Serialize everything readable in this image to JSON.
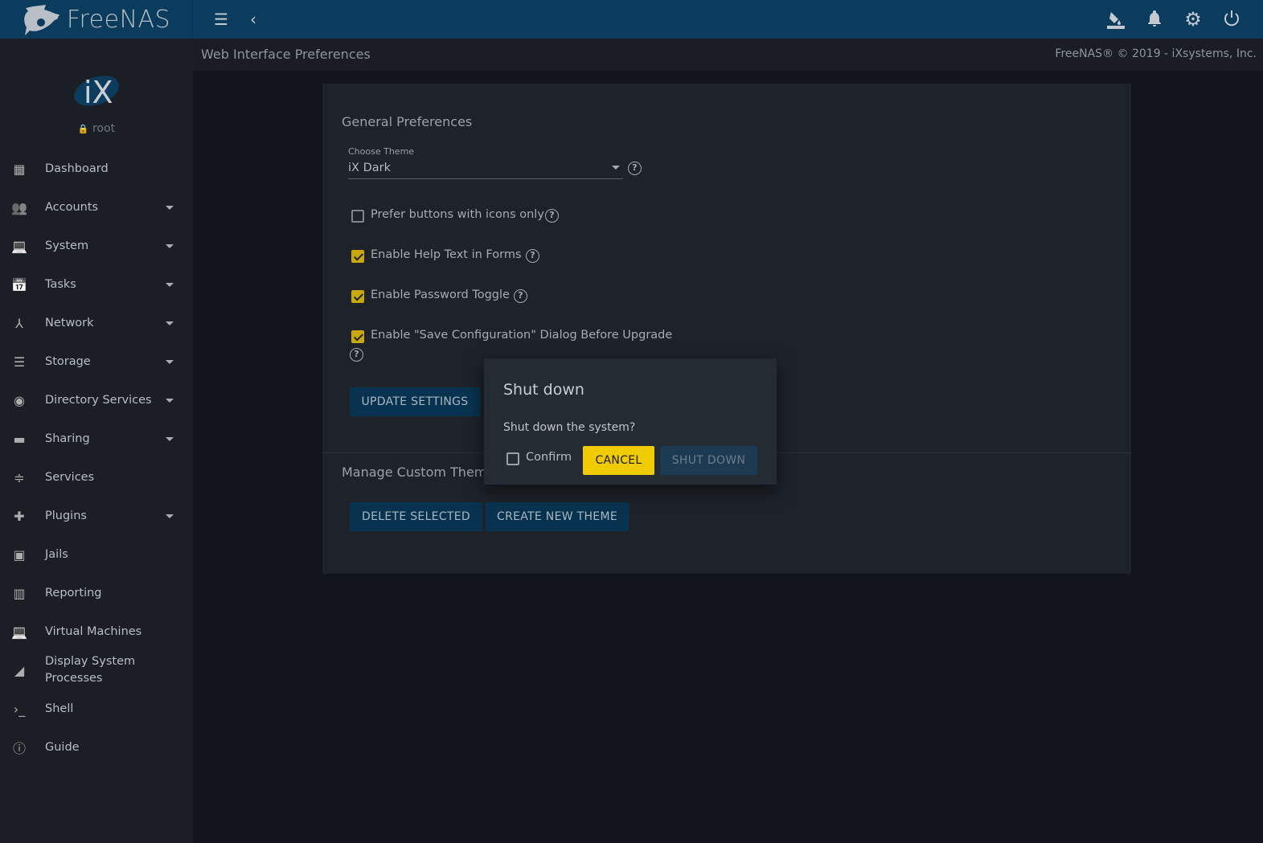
{
  "topbar": {
    "brand": "FreeNAS",
    "icons": [
      "menu-icon",
      "chevron-left-icon",
      "theme-paint-icon",
      "bell-icon",
      "gear-icon",
      "power-icon"
    ]
  },
  "sidebar": {
    "user": "root",
    "items": [
      {
        "label": "Dashboard",
        "icon": "dashboard-icon",
        "expandable": false
      },
      {
        "label": "Accounts",
        "icon": "people-icon",
        "expandable": true
      },
      {
        "label": "System",
        "icon": "laptop-icon",
        "expandable": true
      },
      {
        "label": "Tasks",
        "icon": "calendar-icon",
        "expandable": true
      },
      {
        "label": "Network",
        "icon": "network-icon",
        "expandable": true
      },
      {
        "label": "Storage",
        "icon": "storage-icon",
        "expandable": true
      },
      {
        "label": "Directory Services",
        "icon": "directory-icon",
        "expandable": true
      },
      {
        "label": "Sharing",
        "icon": "folder-shared-icon",
        "expandable": true
      },
      {
        "label": "Services",
        "icon": "tune-icon",
        "expandable": false
      },
      {
        "label": "Plugins",
        "icon": "puzzle-icon",
        "expandable": true
      },
      {
        "label": "Jails",
        "icon": "jail-icon",
        "expandable": false
      },
      {
        "label": "Reporting",
        "icon": "chart-icon",
        "expandable": false
      },
      {
        "label": "Virtual Machines",
        "icon": "laptop-icon",
        "expandable": false
      },
      {
        "label": "Display System Processes",
        "icon": "processes-icon",
        "expandable": false
      },
      {
        "label": "Shell",
        "icon": "terminal-icon",
        "expandable": false
      },
      {
        "label": "Guide",
        "icon": "info-icon",
        "expandable": false
      }
    ]
  },
  "breadcrumb": {
    "title": "Web Interface Preferences",
    "copyright": "FreeNAS® © 2019 - iXsystems, Inc."
  },
  "general": {
    "heading": "General Preferences",
    "theme_label": "Choose Theme",
    "theme_value": "iX Dark",
    "checkboxes": [
      {
        "label": "Prefer buttons with icons only",
        "checked": false
      },
      {
        "label": "Enable Help Text in Forms",
        "checked": true
      },
      {
        "label": "Enable Password Toggle",
        "checked": true
      },
      {
        "label": "Enable \"Save Configuration\" Dialog Before Upgrade",
        "checked": true
      }
    ],
    "update_button": "UPDATE SETTINGS"
  },
  "custom": {
    "heading": "Manage Custom Themes",
    "delete_button": "DELETE SELECTED",
    "create_button": "CREATE NEW THEME"
  },
  "dialog": {
    "title": "Shut down",
    "message": "Shut down the system?",
    "confirm_label": "Confirm",
    "confirm_checked": false,
    "cancel": "CANCEL",
    "shutdown": "SHUT DOWN",
    "cancel_color": "#f0cb00"
  }
}
